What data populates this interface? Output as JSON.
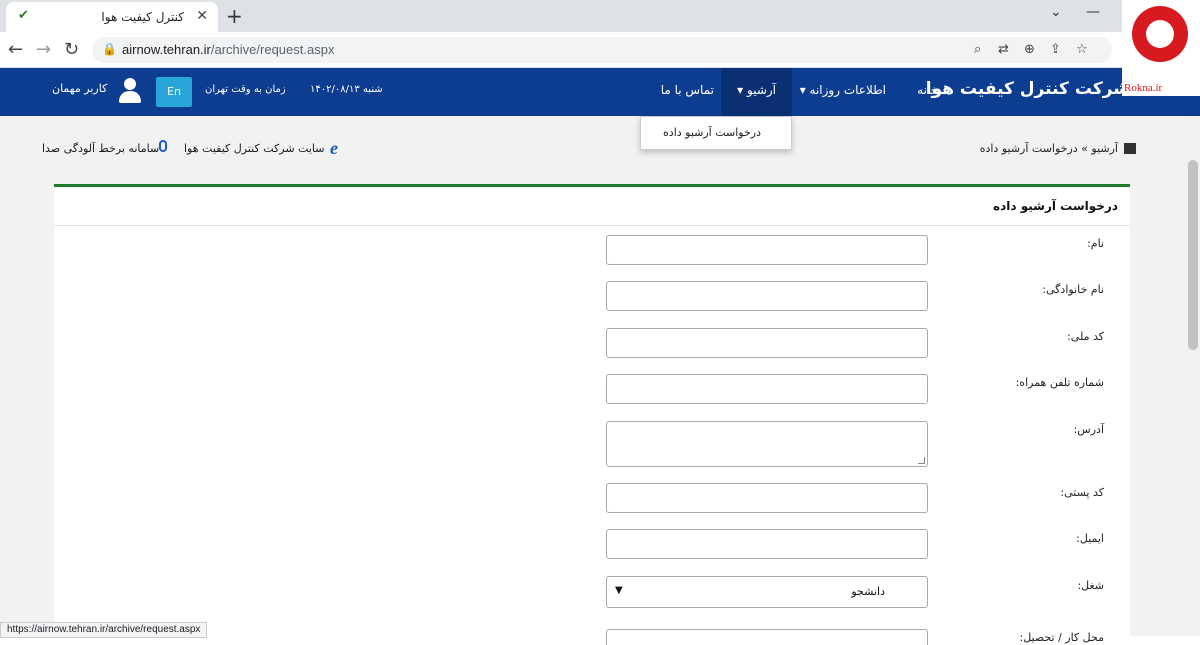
{
  "browser": {
    "tab_title": "کنترل کیفیت هوا",
    "url_host": "airnow.tehran.ir",
    "url_path": "/archive/request.aspx",
    "status_url": "https://airnow.tehran.ir/archive/request.aspx"
  },
  "header": {
    "brand": "شرکت کنترل کیفیت هوا",
    "nav": {
      "home": "خانه",
      "daily": "اطلاعات روزانه ▾",
      "archive": "آرشیو ▾",
      "contact": "تماس با ما"
    },
    "date": "شنبه ۱۴۰۲/۰۸/۱۳",
    "time_label": "زمان به وقت تهران",
    "lang_button": "En",
    "user": "کاربر مهمان"
  },
  "dropdown": {
    "item": "درخواست آرشیو داده"
  },
  "breadcrumb": "آرشیو  »  درخواست آرشیو داده",
  "top_links": {
    "site": "سایت شرکت کنترل کیفیت هوا",
    "sound": "سامانه برخط آلودگی صدا"
  },
  "form": {
    "title": "درخواست آرشیو داده",
    "labels": {
      "first_name": "نام:",
      "last_name": "نام خانوادگی:",
      "national_code": "کد ملی:",
      "mobile": "شماره تلفن همراه:",
      "address": "آدرس:",
      "postal_code": "کد پستی:",
      "email": "ایمیل:",
      "job": "شغل:",
      "workplace": "محل کار / تحصیل:"
    },
    "job_value": "دانشجو"
  },
  "watermark": "Rokna.ir",
  "colors": {
    "header_bg": "#0d3d91",
    "accent_green": "#1f7a2e",
    "lang_button": "#2aa5d9"
  }
}
